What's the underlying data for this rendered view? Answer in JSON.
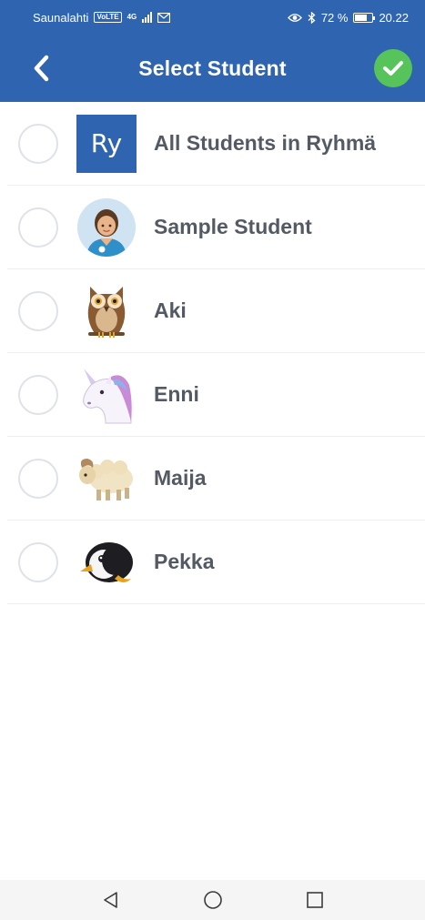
{
  "status_bar": {
    "carrier": "Saunalahti",
    "volte": "VoLTE",
    "network": "4G",
    "battery": "72 %",
    "battery_level": 0.72,
    "time": "20.22"
  },
  "header": {
    "title": "Select Student",
    "accent_color": "#2f64b0",
    "confirm_color": "#56c45a"
  },
  "students": [
    {
      "name": "All Students in Ryhmä",
      "avatar_text": "Ry",
      "avatar": "group-avatar"
    },
    {
      "name": "Sample Student",
      "avatar": "person-avatar"
    },
    {
      "name": "Aki",
      "avatar": "owl-emoji"
    },
    {
      "name": "Enni",
      "avatar": "unicorn-emoji"
    },
    {
      "name": "Maija",
      "avatar": "ram-emoji"
    },
    {
      "name": "Pekka",
      "avatar": "penguin-emoji"
    }
  ]
}
